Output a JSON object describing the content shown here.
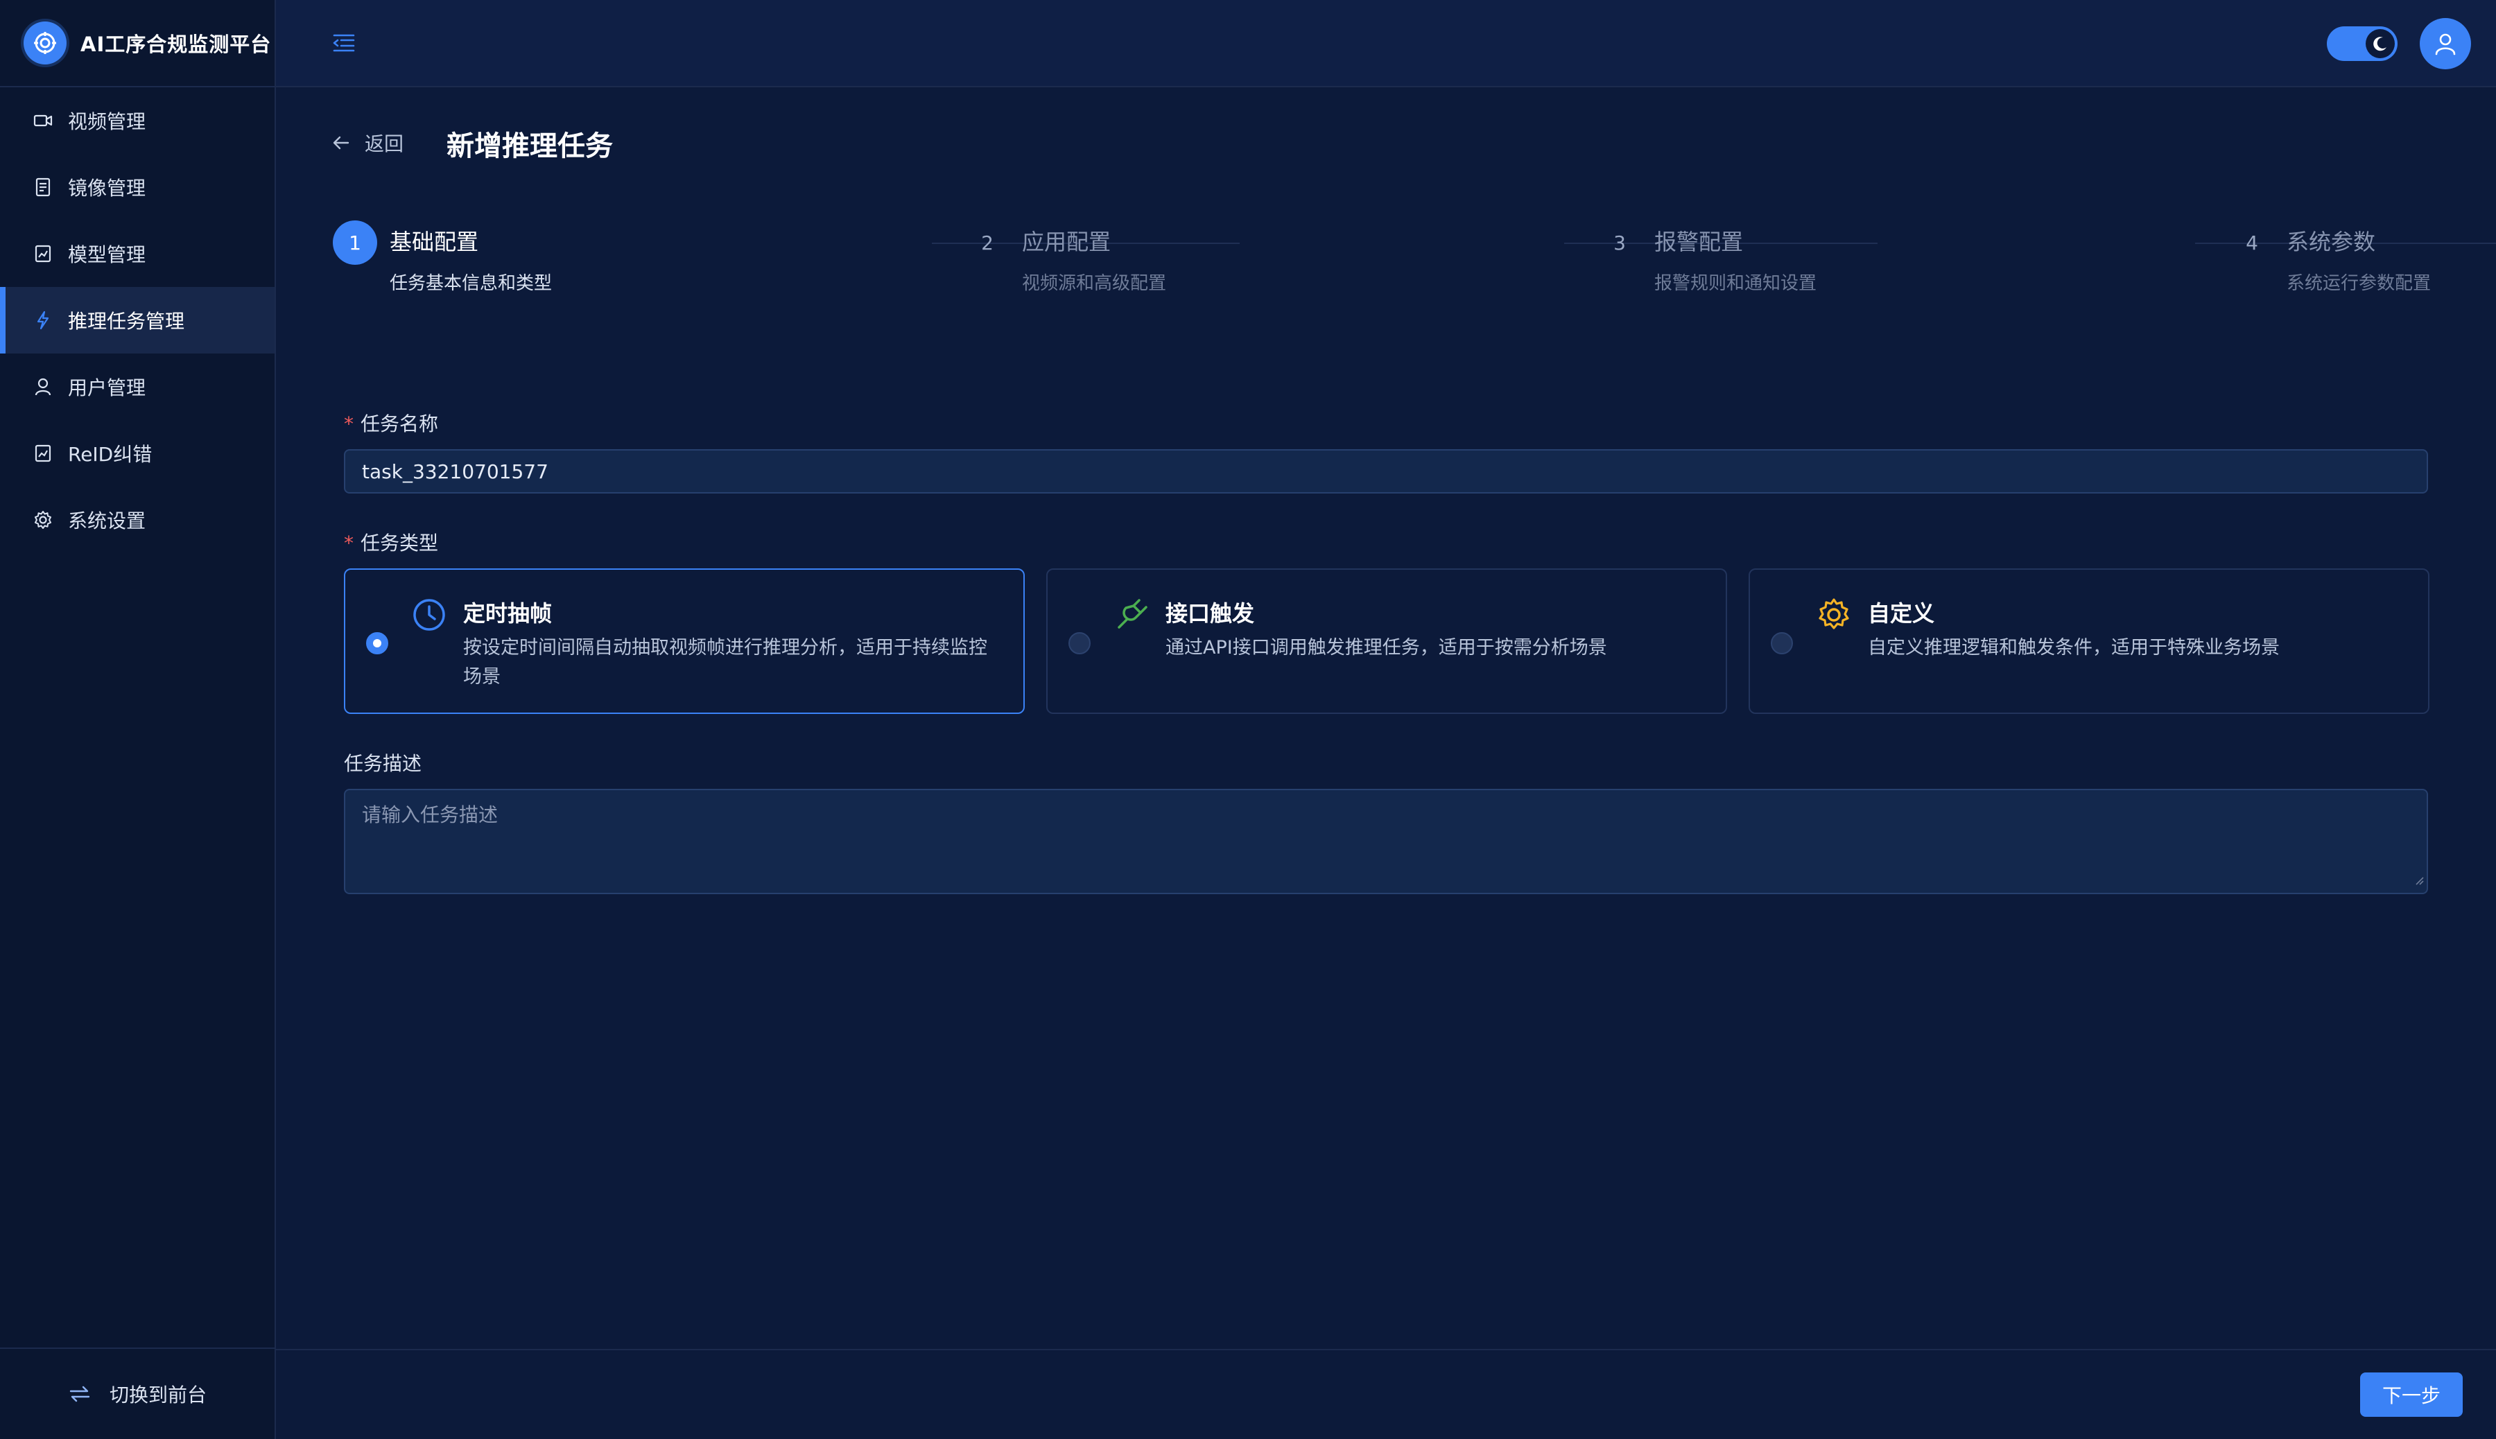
{
  "app": {
    "title": "AI工序合规监测平台"
  },
  "sidebar": {
    "items": [
      {
        "label": "视频管理",
        "icon": "video-icon"
      },
      {
        "label": "镜像管理",
        "icon": "image-icon"
      },
      {
        "label": "模型管理",
        "icon": "model-icon"
      },
      {
        "label": "推理任务管理",
        "icon": "bolt-icon",
        "active": true
      },
      {
        "label": "用户管理",
        "icon": "user-icon"
      },
      {
        "label": "ReID纠错",
        "icon": "reid-icon"
      },
      {
        "label": "系统设置",
        "icon": "gear-icon"
      }
    ],
    "footer_label": "切换到前台"
  },
  "header": {
    "theme": "dark"
  },
  "page": {
    "back_label": "返回",
    "title": "新增推理任务"
  },
  "steps": [
    {
      "num": "1",
      "title": "基础配置",
      "subtitle": "任务基本信息和类型",
      "active": true
    },
    {
      "num": "2",
      "title": "应用配置",
      "subtitle": "视频源和高级配置"
    },
    {
      "num": "3",
      "title": "报警配置",
      "subtitle": "报警规则和通知设置"
    },
    {
      "num": "4",
      "title": "系统参数",
      "subtitle": "系统运行参数配置"
    }
  ],
  "form": {
    "required_mark": "*",
    "task_name": {
      "label": "任务名称",
      "value": "task_33210701577"
    },
    "task_type": {
      "label": "任务类型",
      "options": [
        {
          "title": "定时抽帧",
          "desc": "按设定时间间隔自动抽取视频帧进行推理分析，适用于持续监控场景",
          "icon": "clock-icon",
          "selected": true
        },
        {
          "title": "接口触发",
          "desc": "通过API接口调用触发推理任务，适用于按需分析场景",
          "icon": "plug-icon"
        },
        {
          "title": "自定义",
          "desc": "自定义推理逻辑和触发条件，适用于特殊业务场景",
          "icon": "gear-icon"
        }
      ]
    },
    "task_desc": {
      "label": "任务描述",
      "placeholder": "请输入任务描述"
    }
  },
  "footer": {
    "next_label": "下一步"
  },
  "colors": {
    "accent": "#3b82f6",
    "plug": "#4caf50",
    "gear": "#f5b325",
    "required": "#f05b5b"
  }
}
